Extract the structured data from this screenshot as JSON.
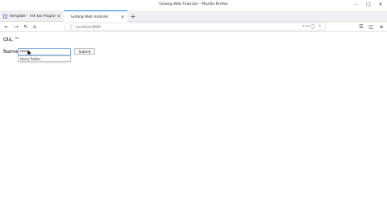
{
  "window": {
    "title": "Golang Web Tutorials - Mozilla Firefox"
  },
  "tabs": [
    {
      "label": "template - The Go Program",
      "active": false
    },
    {
      "label": "Golang Web Tutorials",
      "active": true
    }
  ],
  "navbar": {
    "url": "localhost:8000",
    "overflow": "•••"
  },
  "page": {
    "greeting": "Olá, ™",
    "name_label": "Name",
    "name_value": "Harry",
    "autocomplete_option": "Harry Potter",
    "submit_label": "Submit"
  },
  "colors": {
    "accent": "#0a84ff"
  },
  "icons": {
    "tab1_favicon": "page-icon",
    "back": "back-arrow-icon",
    "forward": "forward-arrow-icon",
    "reload": "reload-icon",
    "home": "home-icon",
    "info": "info-icon",
    "pocket": "pocket-icon",
    "bookmark": "star-icon",
    "library": "library-icon",
    "sidebar": "sidebar-icon",
    "menu": "hamburger-menu-icon"
  }
}
